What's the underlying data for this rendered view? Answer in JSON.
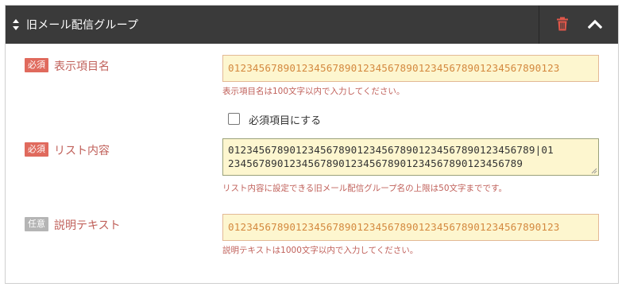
{
  "panel": {
    "title": "旧メール配信グループ",
    "icons": {
      "sort": "sort-updown-icon",
      "delete": "trash-icon",
      "collapse": "chevron-up-icon"
    }
  },
  "fields": {
    "display_name": {
      "badge": "必須",
      "label": "表示項目名",
      "value": "012345678901234567890123456789012345678901234567890123",
      "help": "表示項目名は100文字以内で入力してください。"
    },
    "required_checkbox": {
      "label": "必須項目にする",
      "checked": false
    },
    "list_content": {
      "badge": "必須",
      "label": "リスト内容",
      "lines": [
        "01234567890123456789012345678901234567890123456789|01",
        "234567890123456789012345678901234567890123456789"
      ],
      "help": "リスト内容に設定できる旧メール配信グループ名の上限は50文字までです。"
    },
    "description": {
      "badge": "任意",
      "label": "説明テキスト",
      "value": "012345678901234567890123456789012345678901234567890123",
      "help": "説明テキストは1000文字以内で入力してください。"
    }
  },
  "colors": {
    "header_bg": "#3a3a3a",
    "required_badge": "#e06a5d",
    "optional_badge": "#b5b5b5",
    "label_text": "#c0605a",
    "input_bg": "#fdf6cf",
    "input_text": "#d4893f",
    "trash_icon": "#e0574a"
  }
}
